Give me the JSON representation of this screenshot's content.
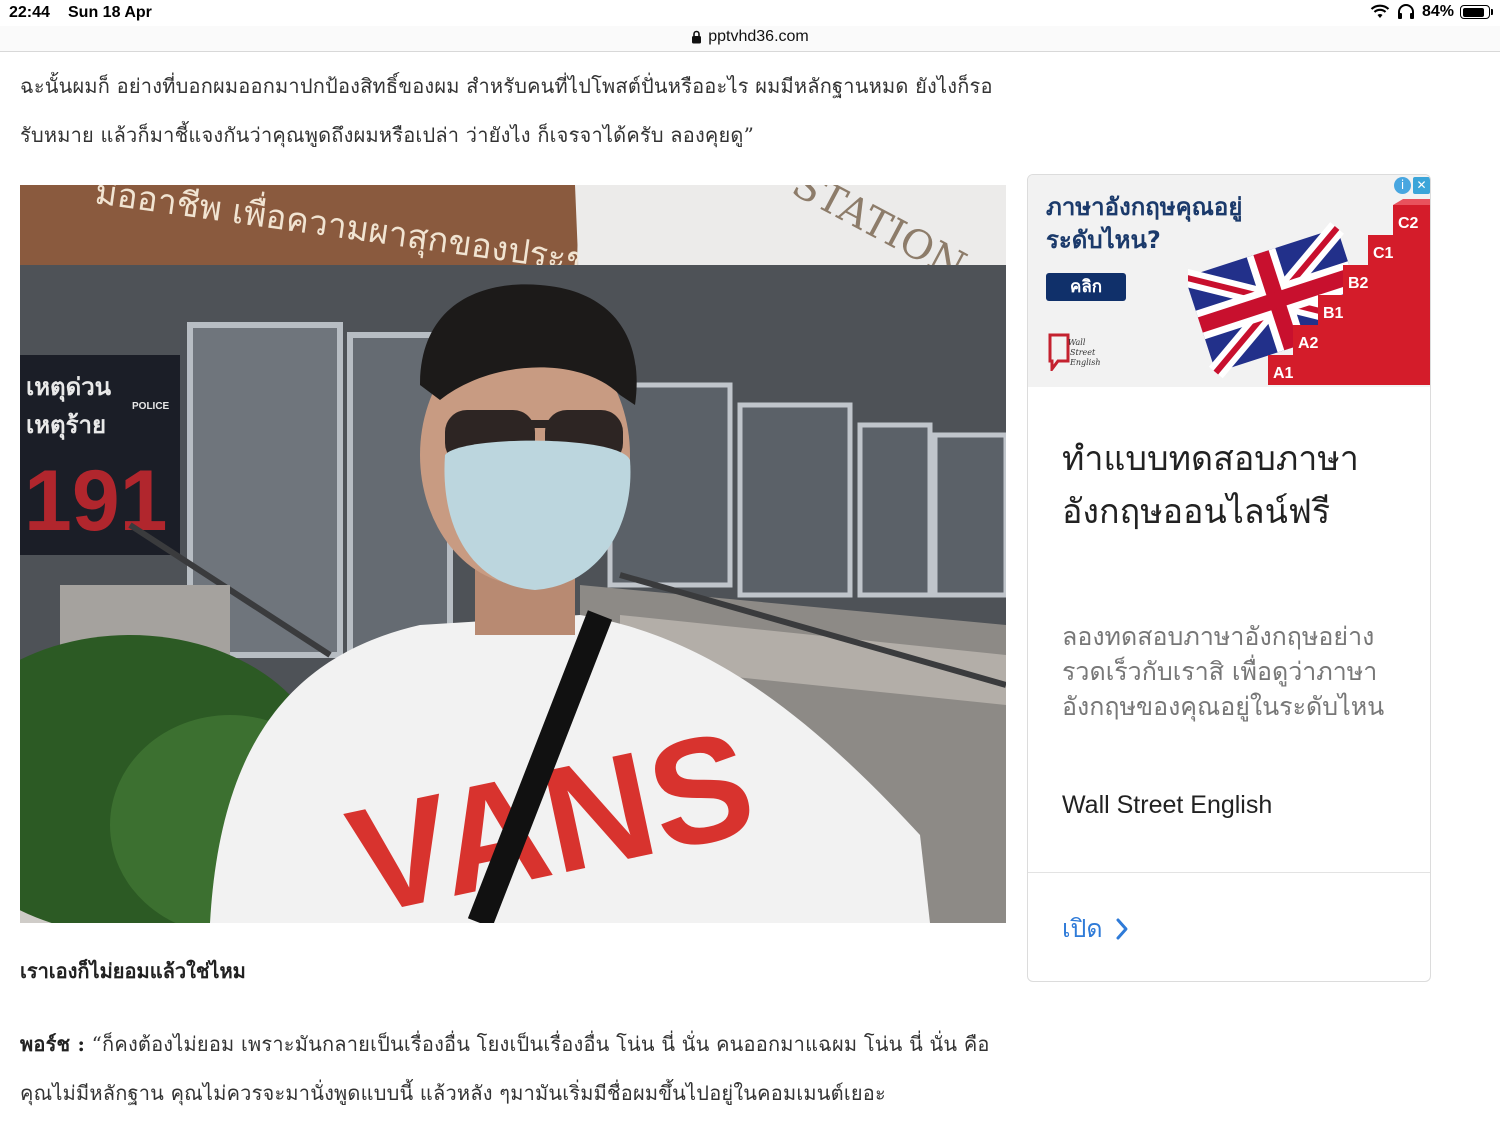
{
  "status_bar": {
    "time": "22:44",
    "date": "Sun 18 Apr",
    "battery": "84%",
    "battery_level": 0.84
  },
  "browser": {
    "url": "pptvhd36.com"
  },
  "article": {
    "paragraph_top": "ฉะนั้นผมก็ อย่างที่บอกผมออกมาปกป้องสิทธิ์ของผม สำหรับคนที่ไปโพสต์ปั่นหรืออะไร ผมมีหลักฐานหมด ยังไงก็รอรับหมาย แล้วก็มาชี้แจงกันว่าคุณพูดถึงผมหรือเปล่า ว่ายังไง ก็เจรจาได้ครับ ลองคุยดู”",
    "question": "เราเองก็ไม่ยอมแล้วใช่ไหม",
    "speaker": "พอร์ช :",
    "answer": "“ก็คงต้องไม่ยอม เพราะมันกลายเป็นเรื่องอื่น โยงเป็นเรื่องอื่น โน่น นี่ นั่น คนออกมาแฉผม โน่น นี่ นั่น คือคุณไม่มีหลักฐาน คุณไม่ควรจะมานั่งพูดแบบนี้ แล้วหลัง ๆมามันเริ่มมีชื่อผมขึ้นไปอยู่ในคอมเมนต์เยอะ",
    "photo": {
      "sign_thai_top": "มืออาชีพ  เพื่อความผาสุกของประชาชน",
      "sign_station": "STATION",
      "poster_line1": "เหตุด่วน",
      "poster_line2": "เหตุร้าย",
      "poster_police": "POLICE",
      "poster_number": "191",
      "shirt_text": "VANS"
    }
  },
  "ad": {
    "banner": {
      "title": "ภาษาอังกฤษคุณอยู่ระดับไหน?",
      "cta": "คลิก",
      "levels": [
        "A1",
        "A2",
        "B1",
        "B2",
        "C1",
        "C2"
      ],
      "logo_text": "Wall Street English"
    },
    "headline": "ทำแบบทดสอบภาษาอังกฤษออนไลน์ฟรี",
    "body": "ลองทดสอบภาษาอังกฤษอย่างรวดเร็วกับเราสิ เพื่อดูว่าภาษาอังกฤษของคุณอยู่ในระดับไหน",
    "advertiser": "Wall Street English",
    "open_label": "เปิด",
    "choices_info": "i",
    "choices_close": "✕"
  }
}
